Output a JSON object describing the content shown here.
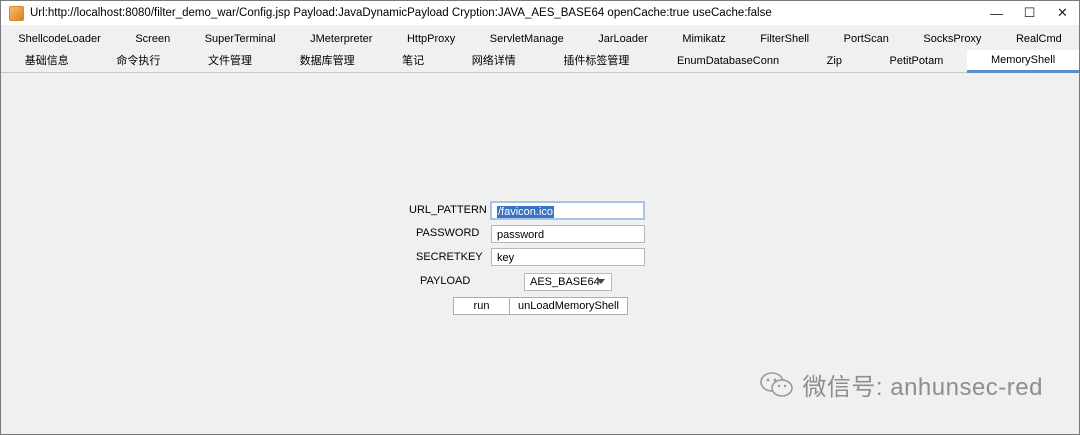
{
  "window": {
    "title": "Url:http://localhost:8080/filter_demo_war/Config.jsp Payload:JavaDynamicPayload Cryption:JAVA_AES_BASE64 openCache:true useCache:false",
    "minimize_glyph": "—",
    "maximize_glyph": "☐",
    "close_glyph": "✕"
  },
  "tabs_row1": [
    "ShellcodeLoader",
    "Screen",
    "SuperTerminal",
    "JMeterpreter",
    "HttpProxy",
    "ServletManage",
    "JarLoader",
    "Mimikatz",
    "FilterShell",
    "PortScan",
    "SocksProxy",
    "RealCmd"
  ],
  "tabs_row2": [
    "基础信息",
    "命令执行",
    "文件管理",
    "数据库管理",
    "笔记",
    "网络详情",
    "插件标签管理",
    "EnumDatabaseConn",
    "Zip",
    "PetitPotam",
    "MemoryShell"
  ],
  "active_tab": "MemoryShell",
  "form": {
    "url_pattern_label": "URL_PATTERN",
    "url_pattern_value": "/favicon.ico",
    "password_label": "PASSWORD",
    "password_value": "password",
    "secretkey_label": "SECRETKEY",
    "secretkey_value": "key",
    "payload_label": "PAYLOAD",
    "payload_value": "AES_BASE64"
  },
  "buttons": {
    "run": "run",
    "unload": "unLoadMemoryShell"
  },
  "watermark": {
    "text": "微信号: anhunsec-red",
    "icon": "wechat-icon"
  }
}
